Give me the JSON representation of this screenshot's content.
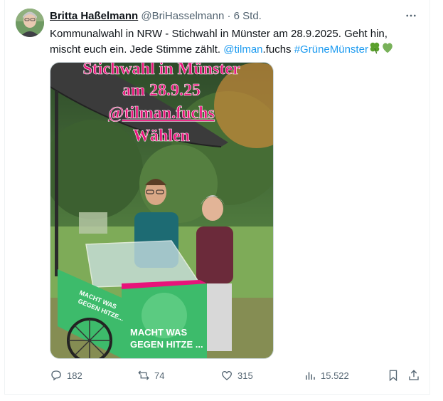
{
  "post": {
    "display_name": "Britta Haßelmann",
    "handle": "@BriHasselmann",
    "separator": "·",
    "time": "6 Std.",
    "text_part1": "Kommunalwahl in NRW - Stichwahl in Münster am 28.9.2025. Geht hin, mischt euch ein. Jede Stimme zählt. ",
    "mention": "@tilman",
    "text_part2": ".fuchs ",
    "hashtag": "#GrüneMünster",
    "emojis": [
      "shamrock-emoji",
      "green-heart-emoji"
    ]
  },
  "image_overlay": {
    "line1": "Stichwahl in Münster",
    "line2": "am 28.9.25",
    "line3": "@tilman.fuchs",
    "line4": "Wählen",
    "cart_slogan_front_1": "MACHT WAS",
    "cart_slogan_front_2": "GEGEN HITZE ...",
    "cart_slogan_side_1": "MACHT WAS",
    "cart_slogan_side_2": "GEGEN HITZE..."
  },
  "actions": {
    "replies": "182",
    "reposts": "74",
    "likes": "315",
    "views": "15.522"
  },
  "colors": {
    "link": "#1d9bf0",
    "muted": "#536471",
    "overlay_text": "#e8137a",
    "cart_green": "#3dbb6b"
  }
}
